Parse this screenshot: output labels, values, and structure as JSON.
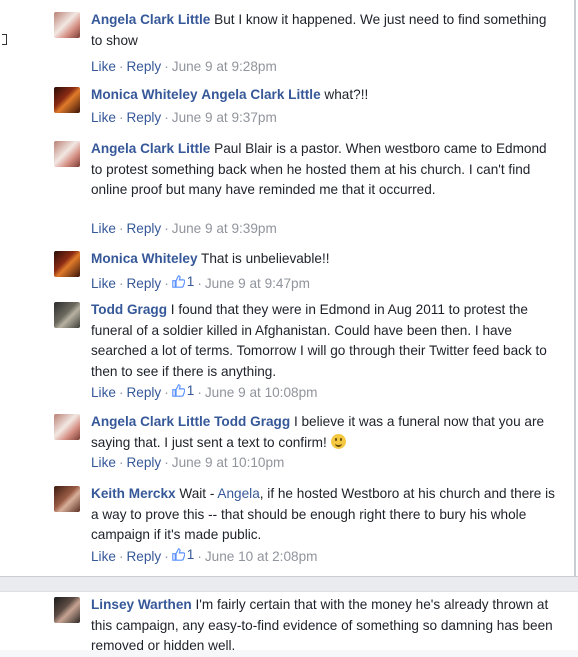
{
  "comments": [
    {
      "author": "Angela Clark Little",
      "mention": "",
      "text": "But I know it happened. We just need to find something to show",
      "actions": {
        "like": "Like",
        "reply": "Reply",
        "time": "June 9 at 9:28pm",
        "likes": ""
      }
    },
    {
      "author": "Monica Whiteley",
      "mention": "Angela Clark Little",
      "text": "what?!!",
      "actions": {
        "like": "Like",
        "reply": "Reply",
        "time": "June 9 at 9:37pm",
        "likes": ""
      }
    },
    {
      "author": "Angela Clark Little",
      "mention": "",
      "text": "Paul Blair is a pastor. When westboro came to Edmond to protest something back when he hosted them at his church. I can't find online proof but many have reminded me that it occurred.",
      "actions": {
        "like": "Like",
        "reply": "Reply",
        "time": "June 9 at 9:39pm",
        "likes": ""
      }
    },
    {
      "author": "Monica Whiteley",
      "mention": "",
      "text": "That is unbelievable!!",
      "actions": {
        "like": "Like",
        "reply": "Reply",
        "time": "June 9 at 9:47pm",
        "likes": "1"
      }
    },
    {
      "author": "Todd Gragg",
      "mention": "",
      "text": "I found that they were in Edmond in Aug 2011 to protest the funeral of a soldier killed in Afghanistan. Could have been then. I have searched a lot of terms. Tomorrow I will go through their Twitter feed back to then to see if there is anything.",
      "actions": {
        "like": "Like",
        "reply": "Reply",
        "time": "June 9 at 10:08pm",
        "likes": "1"
      }
    },
    {
      "author": "Angela Clark Little",
      "mention": "Todd Gragg",
      "text": "I believe it was a funeral now that you are saying that. I just sent a text to confirm!",
      "actions": {
        "like": "Like",
        "reply": "Reply",
        "time": "June 9 at 10:10pm",
        "likes": ""
      }
    },
    {
      "author": "Keith Merckx",
      "mention": "",
      "text_before": "Wait - ",
      "text_link": "Angela",
      "text": ", if he hosted Westboro at his church and there is a way to prove this -- that should be enough right there to bury his whole campaign if it's made public.",
      "actions": {
        "like": "Like",
        "reply": "Reply",
        "time": "June 10 at 2:08pm",
        "likes": "1"
      }
    }
  ],
  "bottom_comment": {
    "author": "Linsey Warthen",
    "text": "I'm fairly certain that with the money he's already thrown at this campaign, any easy-to-find evidence of something so damning has been removed or hidden well."
  },
  "separators": {
    "dot": "·"
  },
  "icons": {
    "like": "thumbs-up-icon",
    "emoji": "smiley-icon"
  },
  "colors": {
    "link": "#365899",
    "meta": "#90949c",
    "text": "#1d2129",
    "divider": "#e9ebee"
  }
}
